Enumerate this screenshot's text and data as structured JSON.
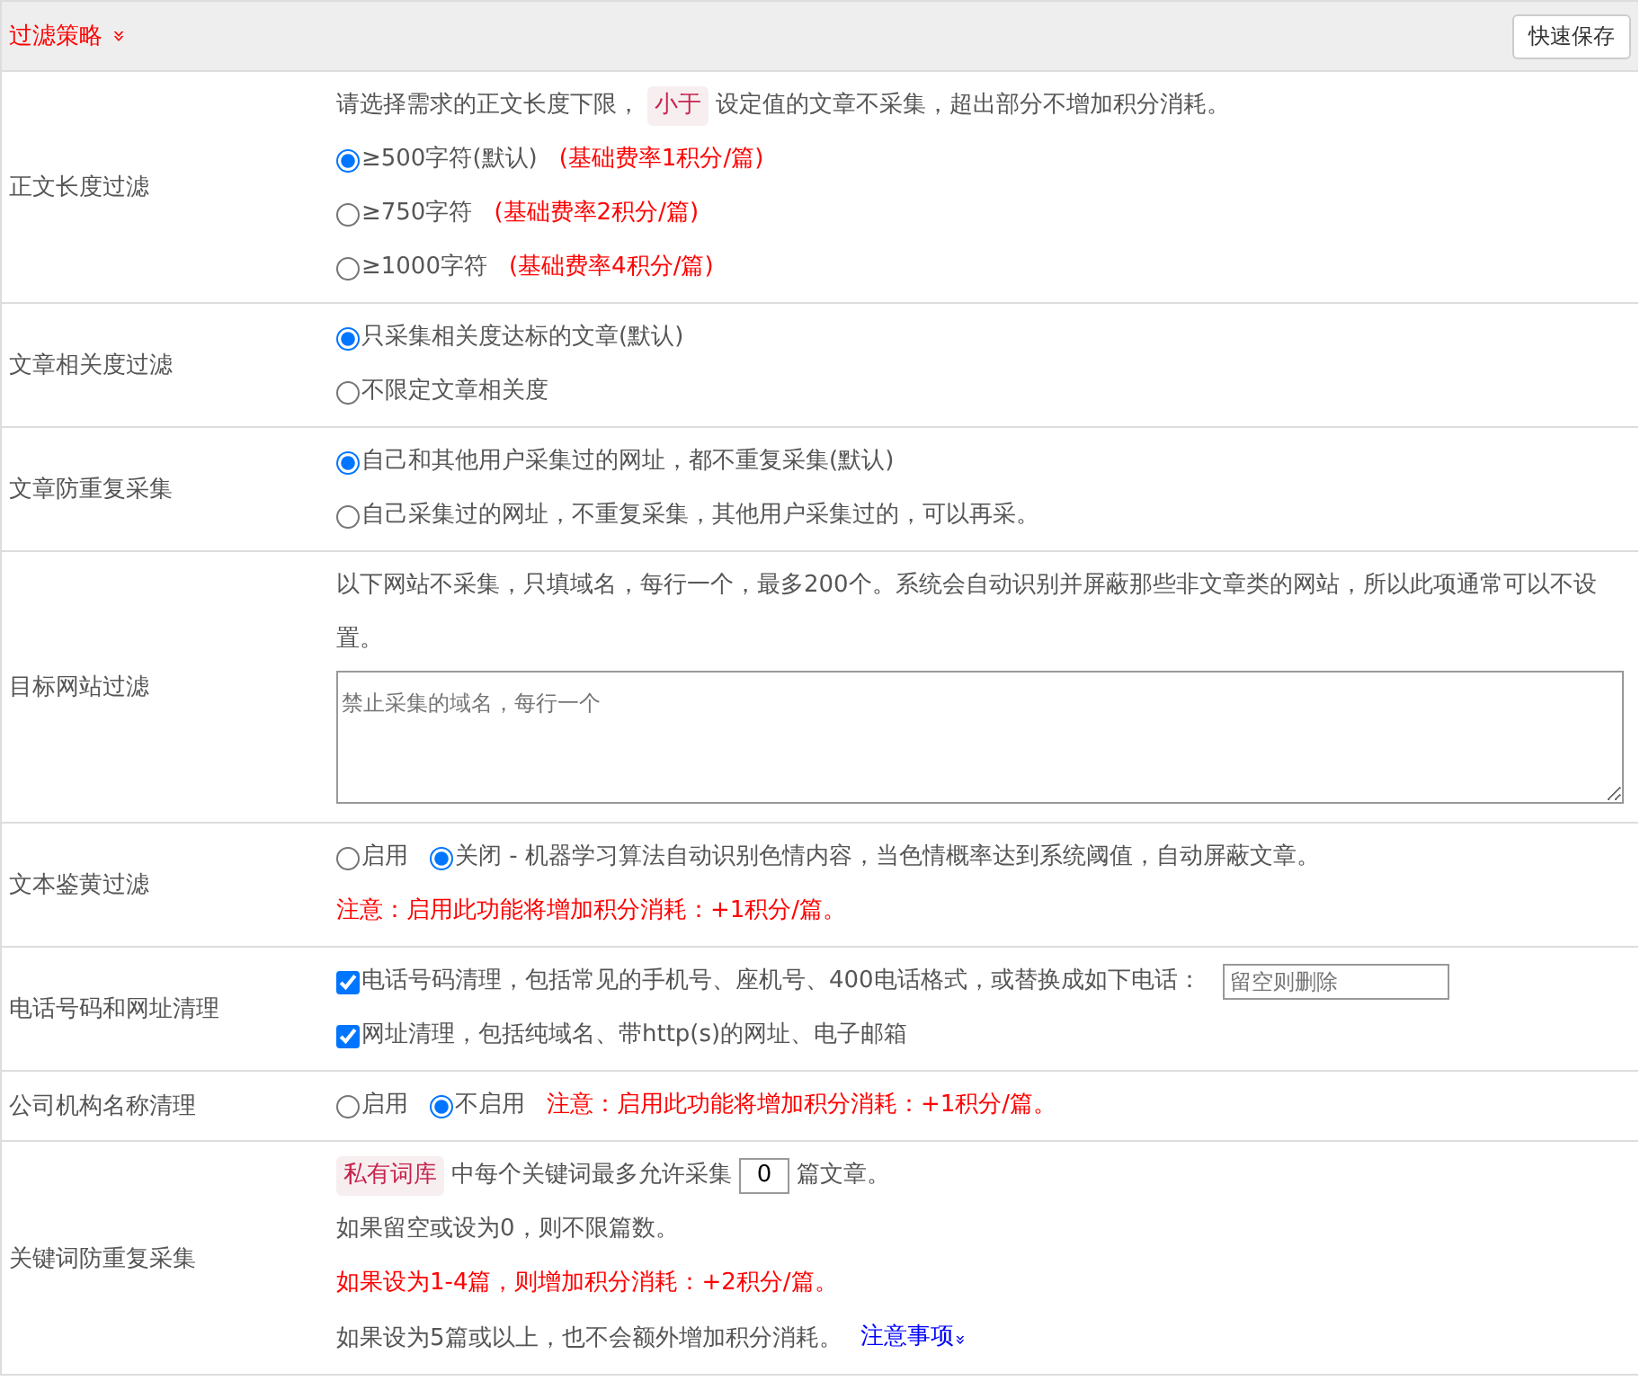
{
  "header": {
    "title": "过滤策略",
    "toggle": "»",
    "button": "快速保存"
  },
  "rows": [
    {
      "label": "正文长度过滤",
      "lines": [
        [
          {
            "kind": "text",
            "text": "请选择需求的正文长度下限，"
          },
          {
            "kind": "tag",
            "text": "小于"
          },
          {
            "kind": "text",
            "text": "设定值的文章不采集，超出部分不增加积分消耗。"
          }
        ],
        [
          {
            "kind": "radio",
            "label": "≥500字符(默认)",
            "selected": true
          },
          {
            "kind": "red",
            "text": "(基础费率1积分/篇)"
          }
        ],
        [
          {
            "kind": "radio",
            "label": "≥750字符",
            "selected": false
          },
          {
            "kind": "red",
            "text": "(基础费率2积分/篇)"
          }
        ],
        [
          {
            "kind": "radio",
            "label": "≥1000字符",
            "selected": false
          },
          {
            "kind": "red",
            "text": "(基础费率4积分/篇)"
          }
        ]
      ]
    },
    {
      "label": "文章相关度过滤",
      "lines": [
        [
          {
            "kind": "radio",
            "label": "只采集相关度达标的文章(默认)",
            "selected": true
          }
        ],
        [
          {
            "kind": "radio",
            "label": "不限定文章相关度",
            "selected": false
          }
        ]
      ]
    },
    {
      "label": "文章防重复采集",
      "lines": [
        [
          {
            "kind": "radio",
            "label": "自己和其他用户采集过的网址，都不重复采集(默认)",
            "selected": true
          }
        ],
        [
          {
            "kind": "radio",
            "label": "自己采集过的网址，不重复采集，其他用户采集过的，可以再采。",
            "selected": false
          }
        ]
      ]
    },
    {
      "label": "目标网站过滤",
      "lines": [
        [
          {
            "kind": "text",
            "text": "以下网站不采集，只填域名，每行一个，最多200个。系统会自动识别并屏蔽那些非文章类的网站，所以此项通常可以不设置。"
          }
        ],
        [
          {
            "kind": "textarea",
            "placeholder": "禁止采集的域名，每行一个"
          }
        ]
      ]
    },
    {
      "label": "文本鉴黄过滤",
      "lines": [
        [
          {
            "kind": "radio",
            "label": "启用",
            "selected": false
          },
          {
            "kind": "radio",
            "label": "关闭 - 机器学习算法自动识别色情内容，当色情概率达到系统阈值，自动屏蔽文章。",
            "selected": true
          }
        ],
        [
          {
            "kind": "red",
            "text": "注意：启用此功能将增加积分消耗：+1积分/篇。"
          }
        ]
      ]
    },
    {
      "label": "电话号码和网址清理",
      "lines": [
        [
          {
            "kind": "checkbox",
            "label": "电话号码清理，包括常见的手机号、座机号、400电话格式，或替换成如下电话：",
            "checked": true
          },
          {
            "kind": "input",
            "placeholder": "留空则删除"
          }
        ],
        [
          {
            "kind": "checkbox",
            "label": "网址清理，包括纯域名、带http(s)的网址、电子邮箱",
            "checked": true
          }
        ]
      ]
    },
    {
      "label": "公司机构名称清理",
      "lines": [
        [
          {
            "kind": "radio",
            "label": "启用",
            "selected": false
          },
          {
            "kind": "radio",
            "label": "不启用",
            "selected": true
          },
          {
            "kind": "red",
            "text": "注意：启用此功能将增加积分消耗：+1积分/篇。"
          }
        ]
      ]
    },
    {
      "label": "关键词防重复采集",
      "lines": [
        [
          {
            "kind": "tag",
            "text": "私有词库"
          },
          {
            "kind": "text",
            "text": "中每个关键词最多允许采集"
          },
          {
            "kind": "number",
            "value": "0"
          },
          {
            "kind": "text",
            "text": "篇文章。"
          }
        ],
        [
          {
            "kind": "text",
            "text": "如果留空或设为0，则不限篇数。"
          }
        ],
        [
          {
            "kind": "red",
            "text": "如果设为1-4篇，则增加积分消耗：+2积分/篇。"
          }
        ],
        [
          {
            "kind": "text",
            "text": "如果设为5篇或以上，也不会额外增加积分消耗。"
          },
          {
            "kind": "link",
            "text": "注意事项",
            "toggle": "»"
          }
        ]
      ]
    }
  ]
}
